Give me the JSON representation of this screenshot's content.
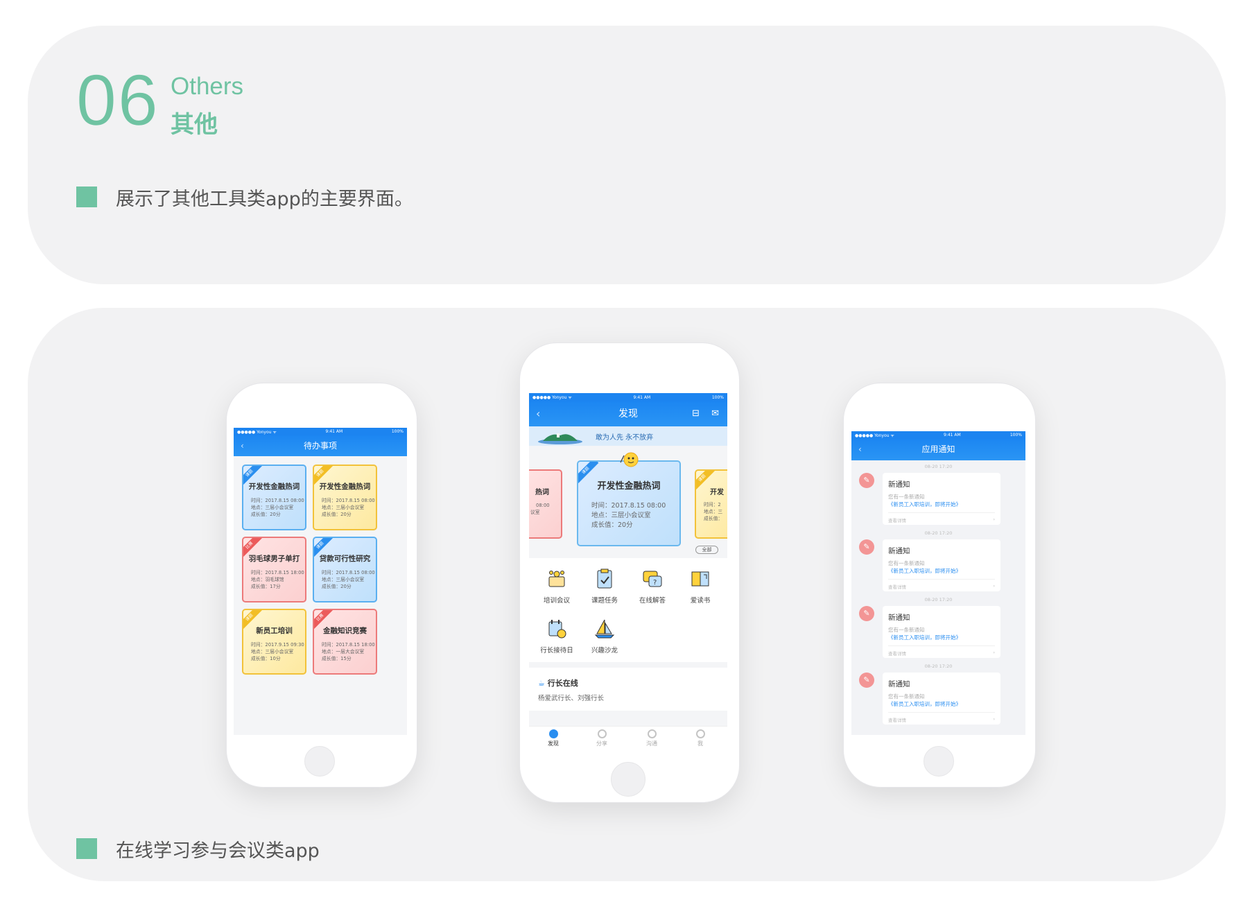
{
  "header": {
    "number": "06",
    "title_en": "Others",
    "title_cn": "其他",
    "description": "展示了其他工具类app的主要界面。"
  },
  "footer": {
    "caption": "在线学习参与会议类app"
  },
  "phone_left": {
    "status": {
      "carrier": "●●●●● Yonyou ᯤ",
      "time": "9:41 AM",
      "battery": "100%"
    },
    "title": "待办事项",
    "cards": [
      {
        "tag": "课题",
        "title": "开发性金融热词",
        "time": "时间：2017.8.15  08:00",
        "place": "地点：三层小会议室",
        "growth": "成长值：20分",
        "color": "blue"
      },
      {
        "tag": "课题",
        "title": "开发性金融热词",
        "time": "时间：2017.8.15  08:00",
        "place": "地点：三层小会议室",
        "growth": "成长值：20分",
        "color": "yellow"
      },
      {
        "tag": "比赛",
        "title": "羽毛球男子单打",
        "time": "时间：2017.8.15  18:00",
        "place": "地点：羽毛球馆",
        "growth": "成长值：17分",
        "color": "red"
      },
      {
        "tag": "课题",
        "title": "贷款可行性研究",
        "time": "时间：2017.8.15  08:00",
        "place": "地点：三层小会议室",
        "growth": "成长值：20分",
        "color": "blue"
      },
      {
        "tag": "课题",
        "title": "新员工培训",
        "time": "时间：2017.9.15  09:30",
        "place": "地点：三层小会议室",
        "growth": "成长值：10分",
        "color": "yellow"
      },
      {
        "tag": "比赛",
        "title": "金融知识竞赛",
        "time": "时间：2017.8.15  18:00",
        "place": "地点：一层大会议室",
        "growth": "成长值：15分",
        "color": "red"
      }
    ]
  },
  "phone_center": {
    "status": {
      "carrier": "●●●●● Yonyou ᯤ",
      "time": "9:41 AM",
      "battery": "100%"
    },
    "title": "发现",
    "banner": "敢为人先  永不放弃",
    "main_card": {
      "tag": "课题",
      "title": "开发性金融热词",
      "time": "时间：2017.8.15  08:00",
      "place": "地点：三层小会议室",
      "growth": "成长值：20分"
    },
    "left_peek": {
      "title": "热词",
      "line1": "08:00",
      "line2": "议室"
    },
    "right_peek": {
      "tag": "课题",
      "title": "开发",
      "line1": "时间：2",
      "line2": "地点：三",
      "line3": "成长值："
    },
    "all_label": "全部",
    "icons": [
      {
        "label": "培训会议",
        "icon": "meeting-icon"
      },
      {
        "label": "课题任务",
        "icon": "task-icon"
      },
      {
        "label": "在线解答",
        "icon": "qa-icon"
      },
      {
        "label": "爱读书",
        "icon": "book-icon"
      },
      {
        "label": "行长接待日",
        "icon": "calendar-icon"
      },
      {
        "label": "兴趣沙龙",
        "icon": "sailboat-icon"
      }
    ],
    "online": {
      "title": "行长在线",
      "names": "杨爱武行长、刘强行长"
    },
    "tabs": [
      {
        "label": "发现",
        "active": true
      },
      {
        "label": "分享",
        "active": false
      },
      {
        "label": "沟通",
        "active": false
      },
      {
        "label": "我",
        "active": false
      }
    ]
  },
  "phone_right": {
    "status": {
      "carrier": "●●●●● Yonyou ᯤ",
      "time": "9:41 AM",
      "battery": "100%"
    },
    "title": "应用通知",
    "notifications": [
      {
        "time": "08-20 17:20",
        "title": "新通知",
        "text": "您有一条新通知",
        "link": "《新员工入职培训，即将开始》",
        "detail": "查看详情"
      },
      {
        "time": "08-20 17:20",
        "title": "新通知",
        "text": "您有一条新通知",
        "link": "《新员工入职培训，即将开始》",
        "detail": "查看详情"
      },
      {
        "time": "08-20 17:20",
        "title": "新通知",
        "text": "您有一条新通知",
        "link": "《新员工入职培训，即将开始》",
        "detail": "查看详情"
      },
      {
        "time": "08-20 17:20",
        "title": "新通知",
        "text": "您有一条新通知",
        "link": "《新员工入职培训，即将开始》",
        "detail": "查看详情"
      }
    ]
  },
  "colors": {
    "accent": "#6fc3a2",
    "nav_blue": "#1c84f0",
    "panel": "#f2f2f3"
  }
}
